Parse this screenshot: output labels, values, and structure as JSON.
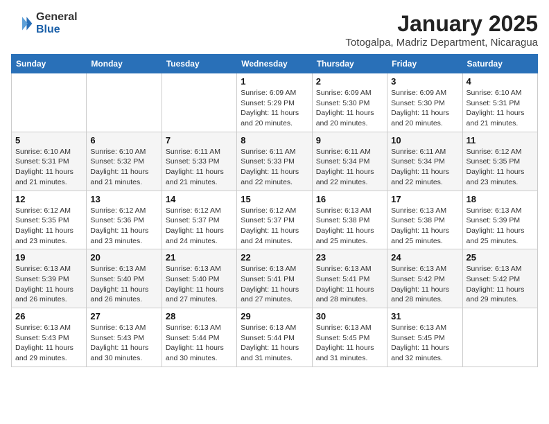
{
  "header": {
    "logo_general": "General",
    "logo_blue": "Blue",
    "month_year": "January 2025",
    "location": "Totogalpa, Madriz Department, Nicaragua"
  },
  "days_of_week": [
    "Sunday",
    "Monday",
    "Tuesday",
    "Wednesday",
    "Thursday",
    "Friday",
    "Saturday"
  ],
  "weeks": [
    [
      {
        "num": "",
        "sunrise": "",
        "sunset": "",
        "daylight": ""
      },
      {
        "num": "",
        "sunrise": "",
        "sunset": "",
        "daylight": ""
      },
      {
        "num": "",
        "sunrise": "",
        "sunset": "",
        "daylight": ""
      },
      {
        "num": "1",
        "sunrise": "Sunrise: 6:09 AM",
        "sunset": "Sunset: 5:29 PM",
        "daylight": "Daylight: 11 hours and 20 minutes."
      },
      {
        "num": "2",
        "sunrise": "Sunrise: 6:09 AM",
        "sunset": "Sunset: 5:30 PM",
        "daylight": "Daylight: 11 hours and 20 minutes."
      },
      {
        "num": "3",
        "sunrise": "Sunrise: 6:09 AM",
        "sunset": "Sunset: 5:30 PM",
        "daylight": "Daylight: 11 hours and 20 minutes."
      },
      {
        "num": "4",
        "sunrise": "Sunrise: 6:10 AM",
        "sunset": "Sunset: 5:31 PM",
        "daylight": "Daylight: 11 hours and 21 minutes."
      }
    ],
    [
      {
        "num": "5",
        "sunrise": "Sunrise: 6:10 AM",
        "sunset": "Sunset: 5:31 PM",
        "daylight": "Daylight: 11 hours and 21 minutes."
      },
      {
        "num": "6",
        "sunrise": "Sunrise: 6:10 AM",
        "sunset": "Sunset: 5:32 PM",
        "daylight": "Daylight: 11 hours and 21 minutes."
      },
      {
        "num": "7",
        "sunrise": "Sunrise: 6:11 AM",
        "sunset": "Sunset: 5:33 PM",
        "daylight": "Daylight: 11 hours and 21 minutes."
      },
      {
        "num": "8",
        "sunrise": "Sunrise: 6:11 AM",
        "sunset": "Sunset: 5:33 PM",
        "daylight": "Daylight: 11 hours and 22 minutes."
      },
      {
        "num": "9",
        "sunrise": "Sunrise: 6:11 AM",
        "sunset": "Sunset: 5:34 PM",
        "daylight": "Daylight: 11 hours and 22 minutes."
      },
      {
        "num": "10",
        "sunrise": "Sunrise: 6:11 AM",
        "sunset": "Sunset: 5:34 PM",
        "daylight": "Daylight: 11 hours and 22 minutes."
      },
      {
        "num": "11",
        "sunrise": "Sunrise: 6:12 AM",
        "sunset": "Sunset: 5:35 PM",
        "daylight": "Daylight: 11 hours and 23 minutes."
      }
    ],
    [
      {
        "num": "12",
        "sunrise": "Sunrise: 6:12 AM",
        "sunset": "Sunset: 5:35 PM",
        "daylight": "Daylight: 11 hours and 23 minutes."
      },
      {
        "num": "13",
        "sunrise": "Sunrise: 6:12 AM",
        "sunset": "Sunset: 5:36 PM",
        "daylight": "Daylight: 11 hours and 23 minutes."
      },
      {
        "num": "14",
        "sunrise": "Sunrise: 6:12 AM",
        "sunset": "Sunset: 5:37 PM",
        "daylight": "Daylight: 11 hours and 24 minutes."
      },
      {
        "num": "15",
        "sunrise": "Sunrise: 6:12 AM",
        "sunset": "Sunset: 5:37 PM",
        "daylight": "Daylight: 11 hours and 24 minutes."
      },
      {
        "num": "16",
        "sunrise": "Sunrise: 6:13 AM",
        "sunset": "Sunset: 5:38 PM",
        "daylight": "Daylight: 11 hours and 25 minutes."
      },
      {
        "num": "17",
        "sunrise": "Sunrise: 6:13 AM",
        "sunset": "Sunset: 5:38 PM",
        "daylight": "Daylight: 11 hours and 25 minutes."
      },
      {
        "num": "18",
        "sunrise": "Sunrise: 6:13 AM",
        "sunset": "Sunset: 5:39 PM",
        "daylight": "Daylight: 11 hours and 25 minutes."
      }
    ],
    [
      {
        "num": "19",
        "sunrise": "Sunrise: 6:13 AM",
        "sunset": "Sunset: 5:39 PM",
        "daylight": "Daylight: 11 hours and 26 minutes."
      },
      {
        "num": "20",
        "sunrise": "Sunrise: 6:13 AM",
        "sunset": "Sunset: 5:40 PM",
        "daylight": "Daylight: 11 hours and 26 minutes."
      },
      {
        "num": "21",
        "sunrise": "Sunrise: 6:13 AM",
        "sunset": "Sunset: 5:40 PM",
        "daylight": "Daylight: 11 hours and 27 minutes."
      },
      {
        "num": "22",
        "sunrise": "Sunrise: 6:13 AM",
        "sunset": "Sunset: 5:41 PM",
        "daylight": "Daylight: 11 hours and 27 minutes."
      },
      {
        "num": "23",
        "sunrise": "Sunrise: 6:13 AM",
        "sunset": "Sunset: 5:41 PM",
        "daylight": "Daylight: 11 hours and 28 minutes."
      },
      {
        "num": "24",
        "sunrise": "Sunrise: 6:13 AM",
        "sunset": "Sunset: 5:42 PM",
        "daylight": "Daylight: 11 hours and 28 minutes."
      },
      {
        "num": "25",
        "sunrise": "Sunrise: 6:13 AM",
        "sunset": "Sunset: 5:42 PM",
        "daylight": "Daylight: 11 hours and 29 minutes."
      }
    ],
    [
      {
        "num": "26",
        "sunrise": "Sunrise: 6:13 AM",
        "sunset": "Sunset: 5:43 PM",
        "daylight": "Daylight: 11 hours and 29 minutes."
      },
      {
        "num": "27",
        "sunrise": "Sunrise: 6:13 AM",
        "sunset": "Sunset: 5:43 PM",
        "daylight": "Daylight: 11 hours and 30 minutes."
      },
      {
        "num": "28",
        "sunrise": "Sunrise: 6:13 AM",
        "sunset": "Sunset: 5:44 PM",
        "daylight": "Daylight: 11 hours and 30 minutes."
      },
      {
        "num": "29",
        "sunrise": "Sunrise: 6:13 AM",
        "sunset": "Sunset: 5:44 PM",
        "daylight": "Daylight: 11 hours and 31 minutes."
      },
      {
        "num": "30",
        "sunrise": "Sunrise: 6:13 AM",
        "sunset": "Sunset: 5:45 PM",
        "daylight": "Daylight: 11 hours and 31 minutes."
      },
      {
        "num": "31",
        "sunrise": "Sunrise: 6:13 AM",
        "sunset": "Sunset: 5:45 PM",
        "daylight": "Daylight: 11 hours and 32 minutes."
      },
      {
        "num": "",
        "sunrise": "",
        "sunset": "",
        "daylight": ""
      }
    ]
  ]
}
